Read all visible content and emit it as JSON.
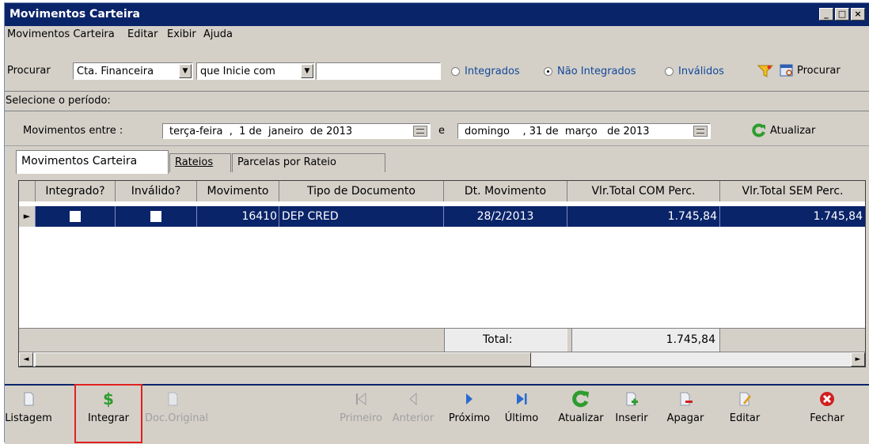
{
  "window": {
    "title": "Movimentos Carteira",
    "controls": [
      "_",
      "□",
      "×"
    ]
  },
  "menu": {
    "items": [
      "Movimentos Carteira",
      "Editar",
      "Exibir",
      "Ajuda"
    ]
  },
  "search": {
    "label": "Procurar",
    "field_value": "Cta. Financeira",
    "condition_value": "que Inicie com",
    "text_value": "",
    "radios": [
      {
        "label": "Integrados",
        "selected": false
      },
      {
        "label": "Não Integrados",
        "selected": true
      },
      {
        "label": "Inválidos",
        "selected": false
      }
    ],
    "button_label": "Procurar"
  },
  "period": {
    "label": "Selecione o período:",
    "range_label": "Movimentos entre :",
    "start_date": "terça-feira  ,  1 de  janeiro  de 2013",
    "and_label": "e",
    "end_date": "domingo    , 31 de  março   de 2013",
    "refresh_label": "Atualizar"
  },
  "tabs": [
    "Movimentos Carteira",
    "Rateios",
    "Parcelas por Rateio"
  ],
  "grid": {
    "columns": [
      "Integrado?",
      "Inválido?",
      "Movimento",
      "Tipo de Documento",
      "Dt. Movimento",
      "Vlr.Total COM Perc.",
      "Vlr.Total SEM Perc."
    ],
    "rows": [
      {
        "integrado": false,
        "invalido": false,
        "movimento": "16410",
        "tipo": "DEP CRED",
        "data": "28/2/2013",
        "vlr_com": "1.745,84",
        "vlr_sem": "1.745,84"
      }
    ],
    "total_label": "Total:",
    "total_value": "1.745,84"
  },
  "toolbar": {
    "buttons": [
      {
        "label": "Listagem",
        "enabled": true,
        "icon": "document-icon"
      },
      {
        "label": "Integrar",
        "enabled": true,
        "icon": "dollar-icon"
      },
      {
        "label": "Doc.Original",
        "enabled": false,
        "icon": "document-icon"
      },
      {
        "label": "Primeiro",
        "enabled": false,
        "icon": "first-icon"
      },
      {
        "label": "Anterior",
        "enabled": false,
        "icon": "prev-icon"
      },
      {
        "label": "Próximo",
        "enabled": true,
        "icon": "next-icon"
      },
      {
        "label": "Último",
        "enabled": true,
        "icon": "last-icon"
      },
      {
        "label": "Atualizar",
        "enabled": true,
        "icon": "refresh-icon"
      },
      {
        "label": "Inserir",
        "enabled": true,
        "icon": "insert-icon"
      },
      {
        "label": "Apagar",
        "enabled": true,
        "icon": "delete-icon"
      },
      {
        "label": "Editar",
        "enabled": true,
        "icon": "edit-icon"
      },
      {
        "label": "Fechar",
        "enabled": true,
        "icon": "close-icon"
      }
    ]
  },
  "colors": {
    "title_bar": "#0a246a",
    "selection": "#0a246a",
    "radio_text": "#12489a",
    "highlight_box": "#e02020",
    "refresh_green": "#2e9c2e"
  }
}
